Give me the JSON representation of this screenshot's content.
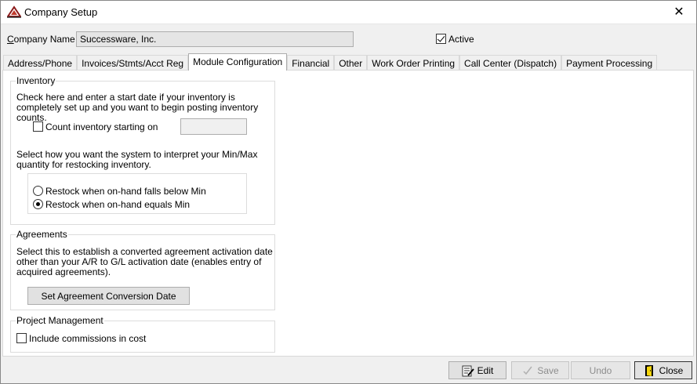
{
  "window": {
    "title": "Company Setup",
    "close_glyph": "✕"
  },
  "company": {
    "name_label": "Company Name",
    "name_value": "Successware, Inc.",
    "active_label": "Active",
    "active_checked": true
  },
  "tabs": [
    {
      "label": "Address/Phone"
    },
    {
      "label": "Invoices/Stmts/Acct Reg"
    },
    {
      "label": "Module Configuration",
      "active": true
    },
    {
      "label": "Financial"
    },
    {
      "label": "Other"
    },
    {
      "label": "Work Order Printing"
    },
    {
      "label": "Call Center (Dispatch)"
    },
    {
      "label": "Payment Processing"
    }
  ],
  "inventory": {
    "legend": "Inventory",
    "start_text_1": "Check here and enter a start date if your inventory is",
    "start_text_2": "completely set up and you want to begin posting inventory",
    "start_text_3": "counts.",
    "count_label": "Count inventory starting on",
    "count_checked": false,
    "count_date": "",
    "minmax_text_1": "Select how you want the system to interpret your Min/Max",
    "minmax_text_2": "quantity for restocking inventory.",
    "restock_options": [
      {
        "label": "Restock when on-hand falls below Min",
        "selected": false
      },
      {
        "label": "Restock when on-hand equals Min",
        "selected": true
      }
    ]
  },
  "agreements": {
    "legend": "Agreements",
    "text_1": "Select this to establish a converted agreement activation date",
    "text_2": "other than your A/R to G/L activation date (enables entry of",
    "text_3": "acquired agreements).",
    "button_label": "Set Agreement Conversion Date"
  },
  "project_management": {
    "legend": "Project Management",
    "commissions_label": "Include commissions in cost",
    "commissions_checked": false
  },
  "footer": {
    "edit_label": "Edit",
    "save_label": "Save",
    "undo_label": "Undo",
    "close_label": "Close"
  },
  "icons": {
    "app": "company-setup-app-icon",
    "edit": "edit-icon",
    "save": "save-check-icon",
    "close": "door-exit-icon"
  }
}
